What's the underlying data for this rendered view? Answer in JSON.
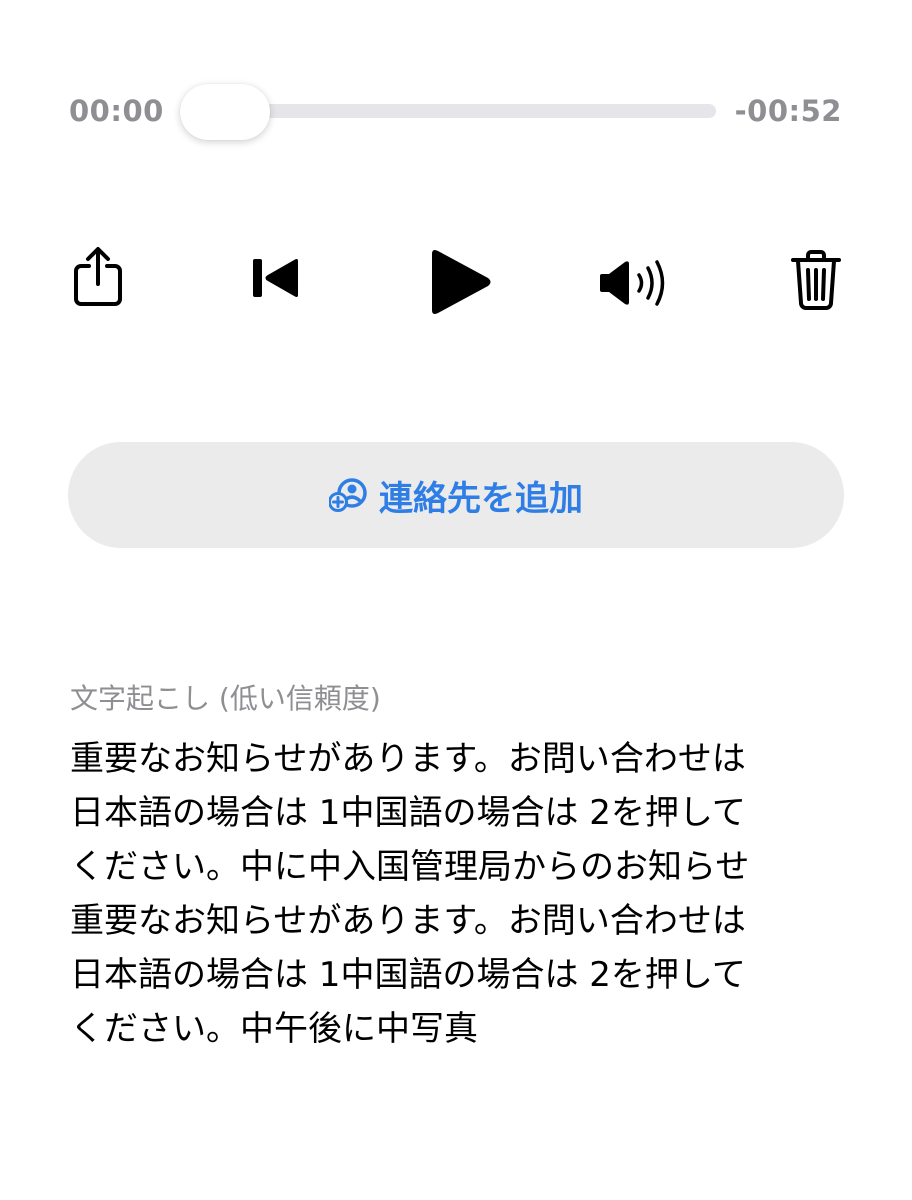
{
  "player": {
    "elapsed": "00:00",
    "remaining": "-00:52",
    "progress": 0
  },
  "controls": {
    "share_icon": "share-icon",
    "back_icon": "skip-back-icon",
    "play_icon": "play-icon",
    "volume_icon": "speaker-volume-icon",
    "trash_icon": "trash-icon"
  },
  "add_contact": {
    "label": "連絡先を追加",
    "icon": "add-contact-icon",
    "color": "#2f7ee6"
  },
  "transcript": {
    "label": "文字起こし (低い信頼度)",
    "lines": [
      "重要なお知らせがあります。お問い合わせは",
      "日本語の場合は 1中国語の場合は 2を押して",
      "ください。中に中入国管理局からのお知らせ",
      "重要なお知らせがあります。お問い合わせは",
      "日本語の場合は 1中国語の場合は 2を押して",
      "ください。中午後に中写真"
    ]
  }
}
